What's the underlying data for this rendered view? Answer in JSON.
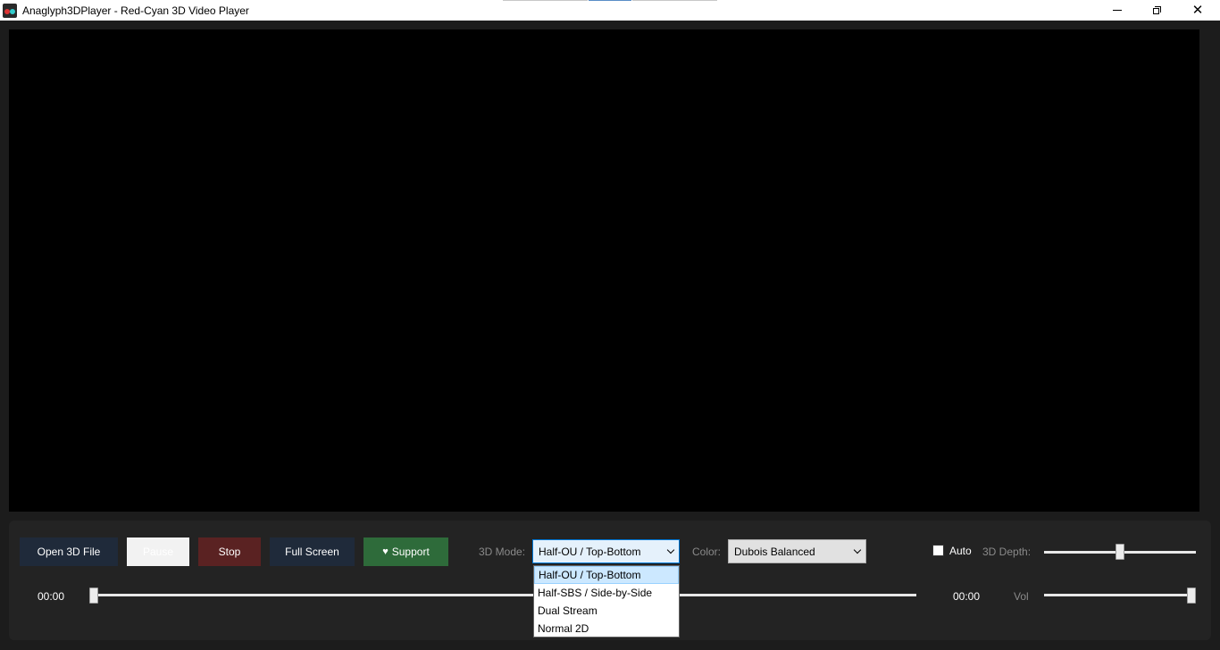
{
  "window": {
    "title": "Anaglyph3DPlayer - Red-Cyan 3D Video Player",
    "minimize_icon": "minimize-icon",
    "restore_icon": "restore-icon",
    "close_icon": "close-icon"
  },
  "toolbar": {
    "open_label": "Open 3D File",
    "pause_label": "Pause",
    "stop_label": "Stop",
    "fullscreen_label": "Full Screen",
    "support_label": "Support",
    "support_icon": "heart-icon"
  },
  "mode": {
    "label": "3D Mode:",
    "selected": "Half-OU / Top-Bottom",
    "options": [
      "Half-OU / Top-Bottom",
      "Half-SBS / Side-by-Side",
      "Dual Stream",
      "Normal 2D"
    ]
  },
  "color": {
    "label": "Color:",
    "selected": "Dubois Balanced"
  },
  "depth": {
    "auto_label": "Auto",
    "auto_checked": false,
    "label": "3D Depth:",
    "level": 0.5
  },
  "playback": {
    "current_time": "00:00",
    "total_time": "00:00",
    "progress": 0
  },
  "volume": {
    "label": "Vol",
    "level": 1.0
  },
  "colors": {
    "background": "#1c1c1c",
    "panel": "#232323",
    "video": "#000000",
    "open_button": "#1f2a3a",
    "stop_button": "#5a2222",
    "support_button": "#2e6b3a"
  }
}
